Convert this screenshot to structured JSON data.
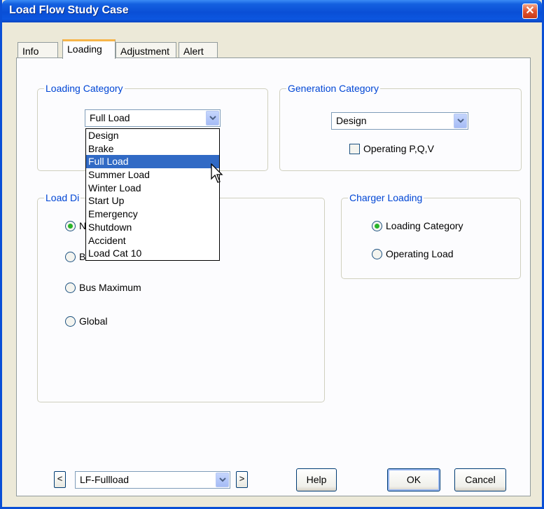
{
  "window": {
    "title": "Load Flow Study Case",
    "close_label": "✕"
  },
  "tabs": [
    {
      "label": "Info"
    },
    {
      "label": "Loading"
    },
    {
      "label": "Adjustment"
    },
    {
      "label": "Alert"
    }
  ],
  "loading_category": {
    "label": "Loading Category",
    "selected": "Full Load",
    "options": [
      "Design",
      "Brake",
      "Full Load",
      "Summer Load",
      "Winter Load",
      "Start Up",
      "Emergency",
      "Shutdown",
      "Accident",
      "Load Cat 10"
    ],
    "highlighted": "Full Load"
  },
  "generation_category": {
    "label": "Generation Category",
    "selected": "Design",
    "operating_checkbox_label": "Operating P,Q,V"
  },
  "load_diversity": {
    "label_visible": "Load Di",
    "options": [
      {
        "label": "N",
        "checked": true
      },
      {
        "label": "B",
        "checked": false
      },
      {
        "label": "Bus Maximum",
        "checked": false
      },
      {
        "label": "Global",
        "checked": false
      }
    ]
  },
  "charger_loading": {
    "label": "Charger Loading",
    "options": [
      {
        "label": "Loading Category",
        "checked": true
      },
      {
        "label": "Operating Load",
        "checked": false
      }
    ]
  },
  "footer": {
    "prev_label": "<",
    "next_label": ">",
    "study_case": "LF-Fullload",
    "help_label": "Help",
    "ok_label": "OK",
    "cancel_label": "Cancel"
  },
  "colors": {
    "title_bar": "#0a4fd6",
    "group_label": "#0046d5",
    "selection": "#316ac5",
    "radio_dot": "#28b428"
  }
}
